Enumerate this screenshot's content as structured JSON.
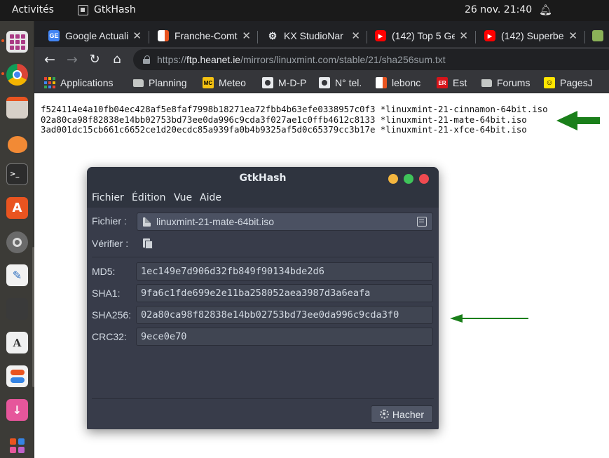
{
  "topbar": {
    "activities": "Activités",
    "app_name": "GtkHash",
    "clock": "26 nov.  21:40",
    "bell_icon": "bell-icon"
  },
  "dock": {
    "items": [
      {
        "name": "app-grid",
        "active": true
      },
      {
        "name": "chrome",
        "active": true
      },
      {
        "name": "files"
      },
      {
        "name": "mango"
      },
      {
        "name": "terminal"
      },
      {
        "name": "software-center"
      },
      {
        "name": "settings"
      },
      {
        "name": "text-editor"
      },
      {
        "name": "calculator"
      },
      {
        "name": "dictionary"
      },
      {
        "name": "tweaks"
      },
      {
        "name": "downloader"
      },
      {
        "name": "show-applications"
      }
    ]
  },
  "browser": {
    "tabs": [
      {
        "title": "Google Actualités",
        "favicon": "google-news-icon",
        "color": "#4285f4",
        "active": false
      },
      {
        "title": "Franche-Comté",
        "favicon": "franche-comte-icon",
        "color": "#e95420",
        "active": false
      },
      {
        "title": "KX StudioNar",
        "favicon": "kx-studio-icon",
        "color": "#9aa0a6",
        "active": false
      },
      {
        "title": "(142) Top 5 Ge",
        "favicon": "youtube-icon",
        "color": "#ff0000",
        "active": false
      },
      {
        "title": "(142) Superbe",
        "favicon": "youtube-icon",
        "color": "#ff0000",
        "active": false
      }
    ],
    "url": {
      "scheme": "https://",
      "host": "ftp.heanet.ie",
      "path": "/mirrors/linuxmint.com/stable/21/sha256sum.txt"
    },
    "bookmarks": [
      {
        "label": "Applications",
        "icon": "apps-grid-icon"
      },
      {
        "label": "Planning",
        "icon": "folder-icon"
      },
      {
        "label": "Meteo",
        "icon": "meteo-icon"
      },
      {
        "label": "M-D-P",
        "icon": "globe-icon"
      },
      {
        "label": "N° tel.",
        "icon": "globe-icon"
      },
      {
        "label": "lebonc",
        "icon": "leboncoin-icon"
      },
      {
        "label": "Est",
        "icon": "est-republicain-icon"
      },
      {
        "label": "Forums",
        "icon": "folder-icon"
      },
      {
        "label": "PagesJ",
        "icon": "pagesjaunes-icon"
      }
    ]
  },
  "page": {
    "lines": [
      "f524114e4a10fb04ec428af5e8faf7998b18271ea72fbb4b63efe0338957c0f3 *linuxmint-21-cinnamon-64bit.iso",
      "02a80ca98f82838e14bb02753bd73ee0da996c9cda3f027ae1c0ffb4612c8133 *linuxmint-21-mate-64bit.iso",
      "3ad001dc15cb661c6652ce1d20ecdc85a939fa0b4b9325af5d0c65379cc3b17e *linuxmint-21-xfce-64bit.iso"
    ]
  },
  "gtkhash": {
    "title": "GtkHash",
    "menu": [
      "Fichier",
      "Édition",
      "Vue",
      "Aide"
    ],
    "file_label": "Fichier :",
    "file_value": "linuxmint-21-mate-64bit.iso",
    "verify_label": "Vérifier :",
    "verify_value": "",
    "hashes": [
      {
        "label": "MD5:",
        "value": "1ec149e7d906d32fb849f90134bde2d6"
      },
      {
        "label": "SHA1:",
        "value": "9fa6c1fde699e2e11ba258052aea3987d3a6eafa"
      },
      {
        "label": "SHA256:",
        "value": "02a80ca98f82838e14bb02753bd73ee0da996c9cda3f0"
      },
      {
        "label": "CRC32:",
        "value": "9ece0e70"
      }
    ],
    "hash_button": "Hacher"
  },
  "colors": {
    "ubuntu_orange": "#e95420",
    "arrow_green": "#1a7f1a",
    "gtk_bg": "#383c4a",
    "gtk_header": "#2f343f"
  }
}
